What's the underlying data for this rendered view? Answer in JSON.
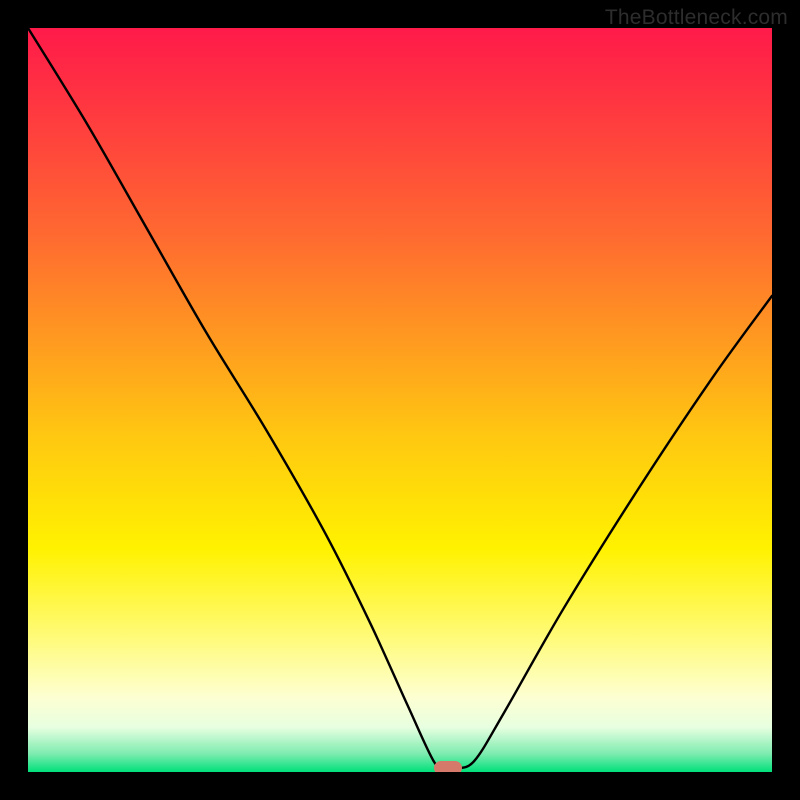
{
  "watermark": "TheBottleneck.com",
  "chart_data": {
    "type": "line",
    "title": "",
    "xlabel": "",
    "ylabel": "",
    "xlim": [
      0,
      100
    ],
    "ylim": [
      0,
      100
    ],
    "grid": false,
    "legend": null,
    "series": [
      {
        "name": "bottleneck-curve",
        "x": [
          0,
          8,
          16,
          24,
          32,
          40,
          46,
          51,
          54.5,
          56,
          57.5,
          60,
          64,
          72,
          82,
          92,
          100
        ],
        "values": [
          100,
          87,
          73,
          59,
          46,
          32,
          20,
          9,
          1.5,
          0.5,
          0.5,
          1.5,
          8,
          22,
          38,
          53,
          64
        ]
      }
    ],
    "marker": {
      "x": 56.5,
      "y": 0.5
    },
    "background_gradient": {
      "top": "#ff1a4a",
      "middle": "#fff200",
      "bottom": "#00e07a"
    }
  }
}
